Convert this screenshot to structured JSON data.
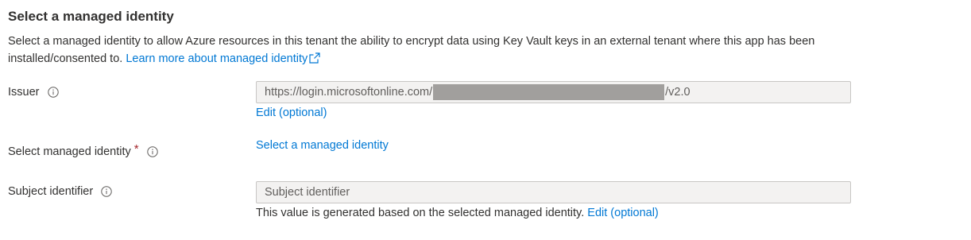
{
  "section": {
    "title": "Select a managed identity",
    "description": "Select a managed identity to allow Azure resources in this tenant the ability to encrypt data using Key Vault keys in an external tenant where this app has been installed/consented to.",
    "learn_more_label": "Learn more about managed identity"
  },
  "issuer": {
    "label": "Issuer",
    "value_prefix": "https://login.microsoftonline.com/",
    "value_suffix": "/v2.0",
    "edit_label": "Edit (optional)"
  },
  "managed_identity": {
    "label": "Select managed identity",
    "required_mark": "*",
    "select_link": "Select a managed identity"
  },
  "subject": {
    "label": "Subject identifier",
    "placeholder": "Subject identifier",
    "helper_text": "This value is generated based on the selected managed identity.",
    "edit_label": "Edit (optional)"
  },
  "icons": {
    "info": "info-icon",
    "external_link": "external-link-icon"
  },
  "colors": {
    "link": "#0078d4",
    "required": "#a4262c",
    "text": "#323130",
    "field_background": "#f3f2f1"
  }
}
